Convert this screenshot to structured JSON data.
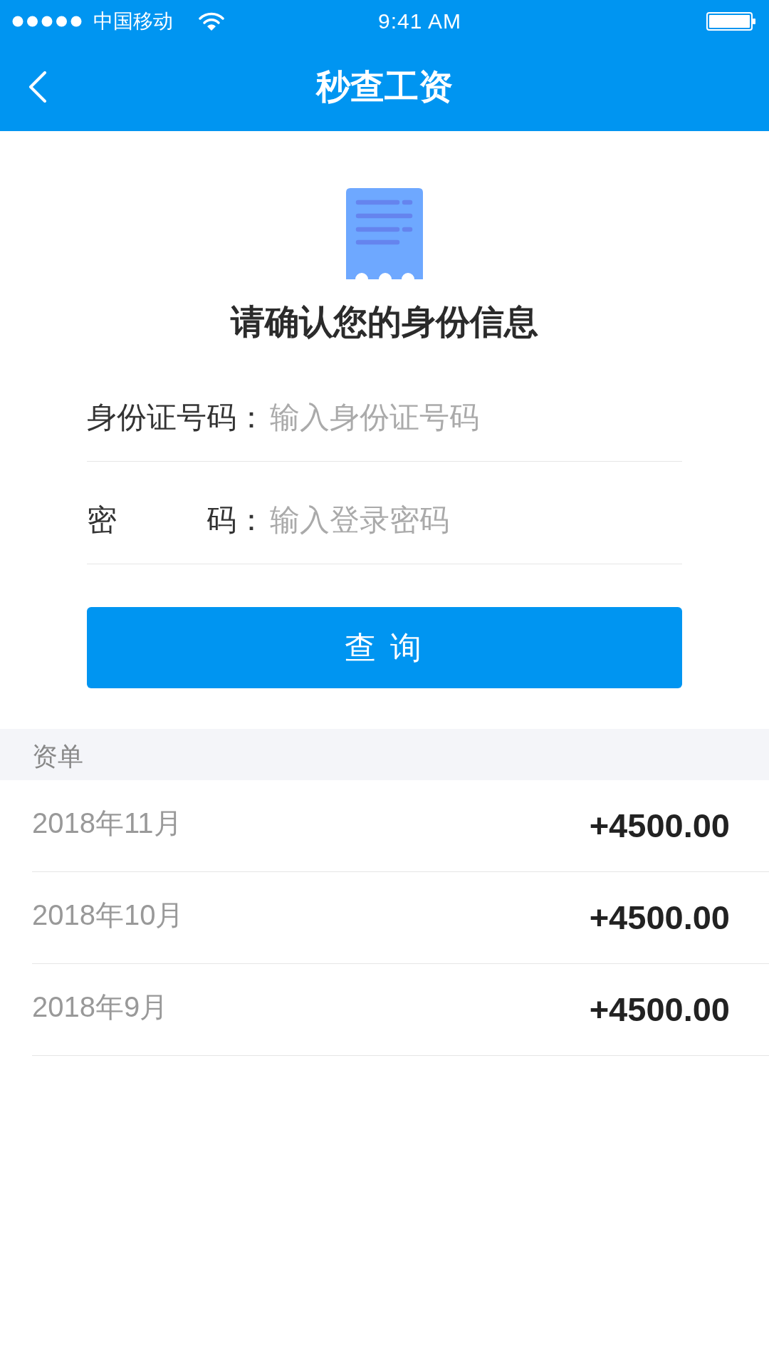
{
  "status_bar": {
    "carrier": "中国移动",
    "time": "9:41 AM"
  },
  "nav_bar": {
    "title": "秒查工资"
  },
  "identity_form": {
    "heading": "请确认您的身份信息",
    "fields": [
      {
        "label": "身份证号码：",
        "placeholder": "输入身份证号码"
      },
      {
        "label": "密 码：",
        "placeholder": "输入登录密码"
      }
    ],
    "submit_button": "查 询"
  },
  "salary_list": {
    "header": "资单",
    "records": [
      {
        "month": "2018年11月",
        "amount": "+4500.00"
      },
      {
        "month": "2018年10月",
        "amount": "+4500.00"
      },
      {
        "month": "2018年9月",
        "amount": "+4500.00"
      }
    ]
  }
}
